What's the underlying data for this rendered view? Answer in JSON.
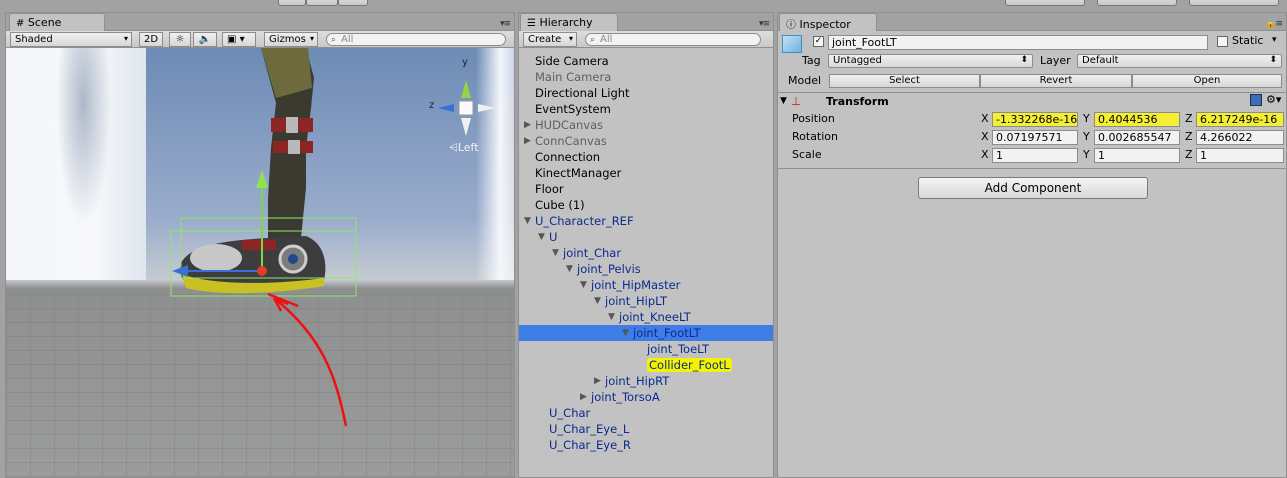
{
  "scene": {
    "tab": "Scene",
    "shading": "Shaded",
    "btn_2d": "2D",
    "gizmos": "Gizmos",
    "search_placeholder": "Q▾All",
    "gizmo_view_label": "Left",
    "gizmo_x": "z",
    "gizmo_y": "y"
  },
  "hierarchy": {
    "tab": "Hierarchy",
    "create": "Create",
    "search_placeholder": "Q▾All",
    "items": [
      {
        "label": "Side Camera",
        "depth": 0,
        "style": "normal",
        "arrow": ""
      },
      {
        "label": "Main Camera",
        "depth": 0,
        "style": "gray",
        "arrow": ""
      },
      {
        "label": "Directional Light",
        "depth": 0,
        "style": "normal",
        "arrow": ""
      },
      {
        "label": "EventSystem",
        "depth": 0,
        "style": "normal",
        "arrow": ""
      },
      {
        "label": "HUDCanvas",
        "depth": 0,
        "style": "gray",
        "arrow": "▶"
      },
      {
        "label": "ConnCanvas",
        "depth": 0,
        "style": "gray",
        "arrow": "▶"
      },
      {
        "label": "Connection",
        "depth": 0,
        "style": "normal",
        "arrow": ""
      },
      {
        "label": "KinectManager",
        "depth": 0,
        "style": "normal",
        "arrow": ""
      },
      {
        "label": "Floor",
        "depth": 0,
        "style": "normal",
        "arrow": ""
      },
      {
        "label": "Cube (1)",
        "depth": 0,
        "style": "normal",
        "arrow": ""
      },
      {
        "label": "U_Character_REF",
        "depth": 0,
        "style": "blue",
        "arrow": "▼"
      },
      {
        "label": "U",
        "depth": 1,
        "style": "blue",
        "arrow": "▼"
      },
      {
        "label": "joint_Char",
        "depth": 2,
        "style": "blue",
        "arrow": "▼"
      },
      {
        "label": "joint_Pelvis",
        "depth": 3,
        "style": "blue",
        "arrow": "▼"
      },
      {
        "label": "joint_HipMaster",
        "depth": 4,
        "style": "blue",
        "arrow": "▼"
      },
      {
        "label": "joint_HipLT",
        "depth": 5,
        "style": "blue",
        "arrow": "▼"
      },
      {
        "label": "joint_KneeLT",
        "depth": 6,
        "style": "blue",
        "arrow": "▼"
      },
      {
        "label": "joint_FootLT",
        "depth": 7,
        "style": "selected",
        "arrow": "▼"
      },
      {
        "label": "joint_ToeLT",
        "depth": 8,
        "style": "blue",
        "arrow": ""
      },
      {
        "label": "Collider_FootL",
        "depth": 8,
        "style": "highlight",
        "arrow": ""
      },
      {
        "label": "joint_HipRT",
        "depth": 5,
        "style": "blue",
        "arrow": "▶"
      },
      {
        "label": "joint_TorsoA",
        "depth": 4,
        "style": "blue",
        "arrow": "▶"
      },
      {
        "label": "U_Char",
        "depth": 1,
        "style": "blue",
        "arrow": ""
      },
      {
        "label": "U_Char_Eye_L",
        "depth": 1,
        "style": "blue",
        "arrow": ""
      },
      {
        "label": "U_Char_Eye_R",
        "depth": 1,
        "style": "blue",
        "arrow": ""
      }
    ]
  },
  "inspector": {
    "tab": "Inspector",
    "object_name": "joint_FootLT",
    "static_label": "Static",
    "tag_label": "Tag",
    "tag_value": "Untagged",
    "layer_label": "Layer",
    "layer_value": "Default",
    "model_label": "Model",
    "model_buttons": [
      "Select",
      "Revert",
      "Open"
    ],
    "transform_title": "Transform",
    "rows": [
      {
        "label": "Position",
        "x": "-1.332268e-16",
        "y": "0.4044536",
        "z": "6.217249e-16",
        "highlight": true
      },
      {
        "label": "Rotation",
        "x": "0.07197571",
        "y": "0.002685547",
        "z": "4.266022",
        "highlight": false
      },
      {
        "label": "Scale",
        "x": "1",
        "y": "1",
        "z": "1",
        "highlight": false
      }
    ],
    "axis": {
      "x": "X",
      "y": "Y",
      "z": "Z"
    },
    "add_component": "Add Component"
  }
}
